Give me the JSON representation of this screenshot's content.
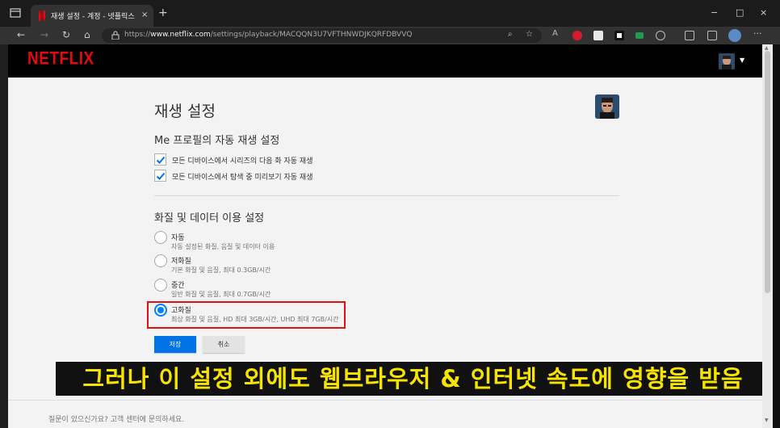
{
  "browser": {
    "tab": {
      "title": "재생 설정 - 계정 - 넷플릭스",
      "close": "×"
    },
    "new_tab": "+",
    "window_controls": {
      "minimize": "−",
      "maximize": "□",
      "close": "×"
    },
    "address": {
      "prefix": "https://",
      "domain": "www.netflix.com",
      "path": "/settings/playback/MACQQN3U7VFTHNWDJKQRFDBVVQ"
    },
    "nav_icons": [
      "back-icon",
      "forward-icon",
      "refresh-icon",
      "home-icon"
    ],
    "more": "···"
  },
  "netflix": {
    "logo": "NETFLIX",
    "brand_color": "#e50914"
  },
  "settings": {
    "title": "재생 설정",
    "autoplay_section": {
      "title": "Me 프로필의 자동 재생 설정",
      "options": [
        {
          "label": "모든 디바이스에서 시리즈의 다음 화 자동 재생",
          "checked": true
        },
        {
          "label": "모든 디바이스에서 탐색 중 미리보기 자동 재생",
          "checked": true
        }
      ]
    },
    "quality_section": {
      "title": "화질 및 데이터 이용 설정",
      "options": [
        {
          "label": "자동",
          "desc": "자동 설정된 화질, 음질 및 데이터 이용",
          "selected": false
        },
        {
          "label": "저화질",
          "desc": "기본 화질 및 음질, 최대 0.3GB/시간",
          "selected": false
        },
        {
          "label": "중간",
          "desc": "일반 화질 및 음질, 최대 0.7GB/시간",
          "selected": false
        },
        {
          "label": "고화질",
          "desc": "최상 화질 및 음질, HD 최대 3GB/시간, UHD 최대 7GB/시간",
          "selected": true
        }
      ]
    },
    "buttons": {
      "save": "저장",
      "cancel": "취소"
    },
    "accent_color": "#0080ff"
  },
  "caption": "그러나 이 설정 외에도 웹브라우저 & 인터넷 속도에 영향을 받음",
  "footer": "질문이 있으신가요? 고객 센터에 문의하세요."
}
